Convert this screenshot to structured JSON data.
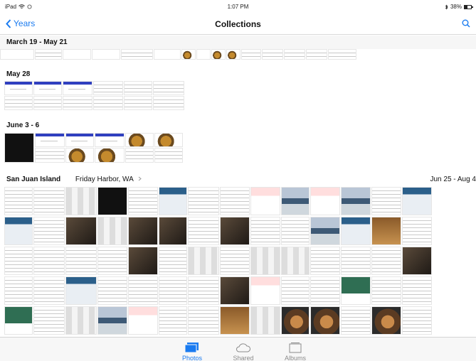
{
  "status": {
    "device": "iPad",
    "time": "1:07 PM",
    "battery": "38%"
  },
  "nav": {
    "back_label": "Years",
    "title": "Collections"
  },
  "collections": [
    {
      "title": "March 19 - May 21"
    },
    {
      "title": "May 28"
    },
    {
      "title": "June 3 - 6"
    },
    {
      "title": "San Juan Island",
      "location": "Friday Harbor, WA",
      "date": "Jun 25 - Aug 4"
    }
  ],
  "tabs": [
    {
      "label": "Photos",
      "active": true
    },
    {
      "label": "Shared",
      "active": false
    },
    {
      "label": "Albums",
      "active": false
    }
  ],
  "colors": {
    "accent": "#1a7bf0",
    "inactive": "#8b8b8b"
  }
}
